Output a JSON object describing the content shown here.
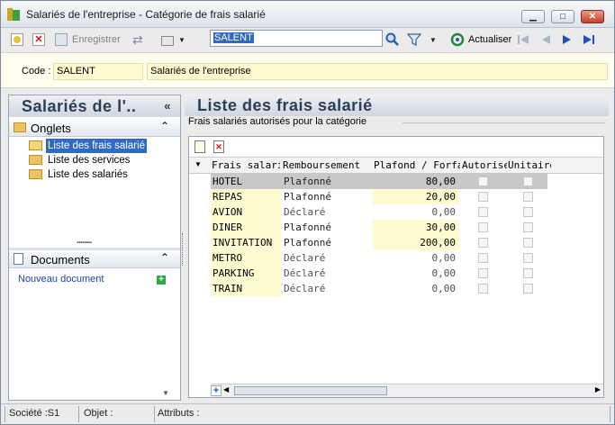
{
  "window": {
    "title": "Salariés de l'entreprise -  Catégorie de frais salarié"
  },
  "toolbar": {
    "save_label": "Enregistrer",
    "search_value": "SALENT",
    "refresh_label": "Actualiser"
  },
  "code": {
    "label": "Code :",
    "value": "SALENT",
    "description": "Salariés de l'entreprise"
  },
  "left": {
    "title": "Salariés de l'..",
    "collapse": "«",
    "tabs_title": "Onglets",
    "tabs": [
      {
        "label": "Liste des frais salarié"
      },
      {
        "label": "Liste des services"
      },
      {
        "label": "Liste des salariés"
      }
    ],
    "documents_title": "Documents",
    "new_doc": "Nouveau document",
    "splitter": "........"
  },
  "right": {
    "title": "Liste des frais salarié",
    "group_label": "Frais salariés autorisés pour la catégorie"
  },
  "grid": {
    "columns": [
      "Frais salarié",
      "Remboursement",
      "Plafond / Forfait",
      "Autorise",
      "Unitaire"
    ],
    "rows": [
      {
        "frais": "HOTEL",
        "remb": "Plafonné",
        "plafond": "80,00"
      },
      {
        "frais": "REPAS",
        "remb": "Plafonné",
        "plafond": "20,00"
      },
      {
        "frais": "AVION",
        "remb": "Déclaré",
        "plafond": "0,00"
      },
      {
        "frais": "DINER",
        "remb": "Plafonné",
        "plafond": "30,00"
      },
      {
        "frais": "INVITATION",
        "remb": "Plafonné",
        "plafond": "200,00"
      },
      {
        "frais": "METRO",
        "remb": "Déclaré",
        "plafond": "0,00"
      },
      {
        "frais": "PARKING",
        "remb": "Déclaré",
        "plafond": "0,00"
      },
      {
        "frais": "TRAIN",
        "remb": "Déclaré",
        "plafond": "0,00"
      }
    ]
  },
  "status": {
    "societe": "Société :S1",
    "objet": "Objet :",
    "attributs": "Attributs :"
  },
  "colors": {
    "selection": "#316ac5",
    "header_text": "#2c3e55",
    "yellow_field": "#fffbd0"
  }
}
